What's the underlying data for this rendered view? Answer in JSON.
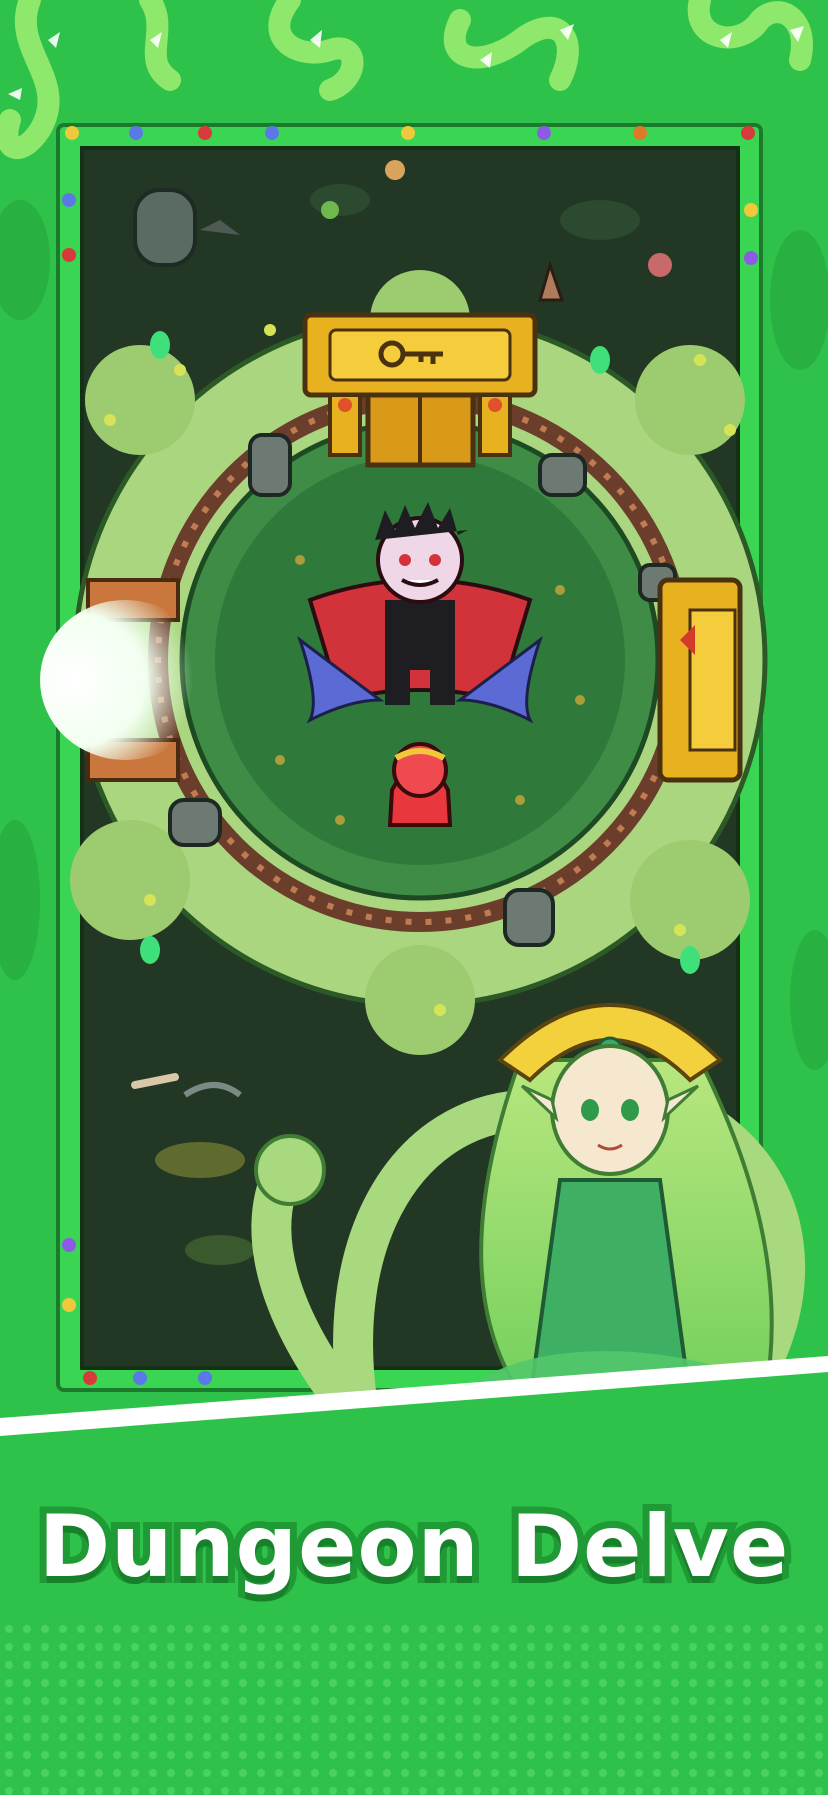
{
  "banner": {
    "title": "Dungeon Delve"
  },
  "colors": {
    "background": "#2fc24a",
    "frame": "#3ad552",
    "dungeon_floor": "#223824",
    "arena_grass": "#2f7a3b",
    "foliage": "#a9d67f",
    "gold": "#e8b11f",
    "cape_red": "#d2333a",
    "hero_red": "#e8383e",
    "title_text": "#ffffff",
    "title_outline": "#1f9a35"
  },
  "icons": {
    "top_door": "golden-key-door-icon",
    "left_exit": "glowing-doorway-icon",
    "right_chest": "golden-chest-icon",
    "boss": "vampire-boss-icon",
    "player": "red-hooded-hero-icon",
    "guide": "forest-elf-queen-icon"
  }
}
